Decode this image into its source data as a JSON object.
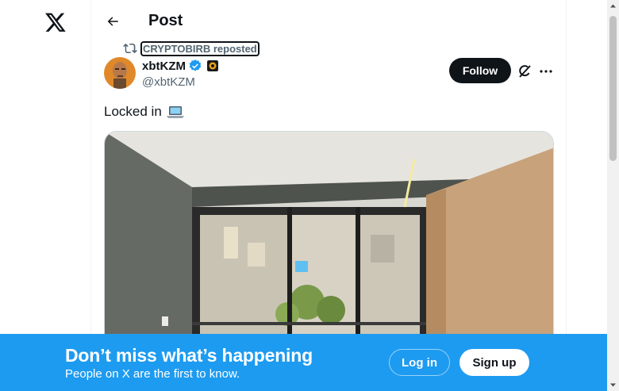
{
  "header": {
    "title": "Post"
  },
  "repost": {
    "label": "CRYPTOBIRB reposted"
  },
  "post": {
    "author_name": "xbtKZM",
    "author_handle": "@xbtKZM",
    "follow_label": "Follow",
    "text": "Locked in"
  },
  "banner": {
    "title": "Don’t miss what’s happening",
    "subtitle": "People on X are the first to know.",
    "login_label": "Log in",
    "signup_label": "Sign up"
  },
  "icons": {
    "logo": "x-logo-icon",
    "back": "back-arrow-icon",
    "repost": "repost-icon",
    "verified": "verified-badge-icon",
    "affiliate": "affiliate-badge-icon",
    "grok": "grok-icon",
    "more": "more-icon",
    "emoji": "laptop-emoji-icon"
  },
  "colors": {
    "accent": "#1d9bf0",
    "text": "#0f1419",
    "muted": "#536471",
    "follow_bg": "#0f1419"
  }
}
